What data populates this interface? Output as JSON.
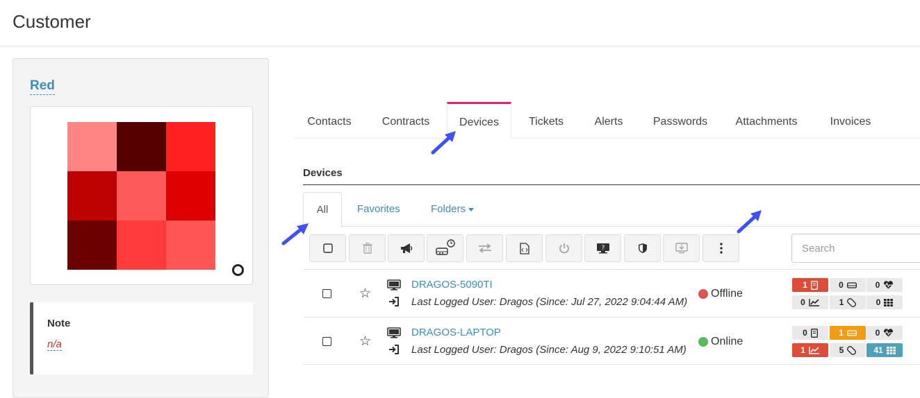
{
  "page": {
    "title": "Customer"
  },
  "customer": {
    "name": "Red",
    "note_title": "Note",
    "note_value": "n/a"
  },
  "avatar_colors": [
    "#ff8585",
    "#560000",
    "#ff2020",
    "#bd0000",
    "#ff5a5a",
    "#dc0000",
    "#6a0000",
    "#ff3a3a",
    "#ff5555"
  ],
  "tabs": [
    {
      "label": "Contacts"
    },
    {
      "label": "Contracts"
    },
    {
      "label": "Devices",
      "active": true
    },
    {
      "label": "Tickets"
    },
    {
      "label": "Alerts"
    },
    {
      "label": "Passwords"
    },
    {
      "label": "Attachments"
    },
    {
      "label": "Invoices"
    }
  ],
  "devices_section": {
    "title": "Devices",
    "subtabs": {
      "all": "All",
      "favorites": "Favorites",
      "folders": "Folders"
    },
    "toolbar": [
      "select-all",
      "delete",
      "announce",
      "schedule-disk",
      "transfer",
      "script",
      "power",
      "remote-desktop",
      "security",
      "install",
      "more"
    ],
    "search_placeholder": "Search"
  },
  "devices": [
    {
      "name": "DRAGOS-5090TI",
      "last_login": "Last Logged User: Dragos (Since: Jul 27, 2022 9:04:44 AM)",
      "status": "Offline",
      "status_color": "#e05252",
      "badges": {
        "alerts": "1",
        "disks": "0",
        "health": "0",
        "performance": "0",
        "patches": "1",
        "apps": "0"
      }
    },
    {
      "name": "DRAGOS-LAPTOP",
      "last_login": "Last Logged User: Dragos (Since: Aug 9, 2022 9:10:51 AM)",
      "status": "Online",
      "status_color": "#5cb85c",
      "badges": {
        "alerts": "0",
        "disks": "1",
        "health": "0",
        "performance": "1",
        "patches": "5",
        "apps": "41"
      }
    }
  ],
  "colors": {
    "accent": "#3c8dbc",
    "active_tab": "#e0236b",
    "pointer_arrow": "#3f51f5"
  }
}
